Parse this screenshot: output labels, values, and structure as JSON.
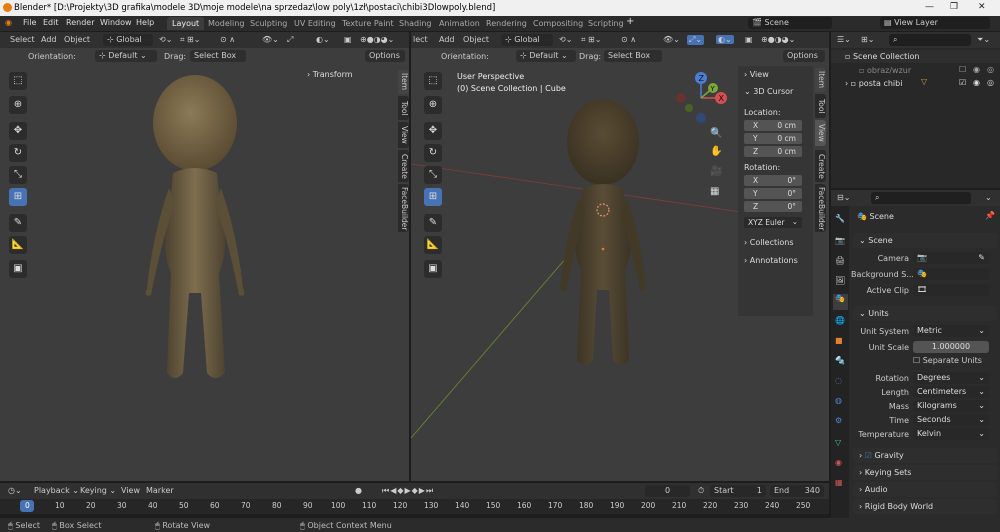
{
  "window": {
    "title": "Blender* [D:\\Projekty\\3D grafika\\modele 3D\\moje modele\\na sprzedaz\\low poly\\1zł\\postaci\\chibi3Dlowpoly.blend]"
  },
  "menus": [
    "File",
    "Edit",
    "Render",
    "Window",
    "Help"
  ],
  "workspaces": [
    "Layout",
    "Modeling",
    "Sculpting",
    "UV Editing",
    "Texture Paint",
    "Shading",
    "Animation",
    "Rendering",
    "Compositing",
    "Scripting"
  ],
  "scene": {
    "label": "Scene",
    "view_layer": "View Layer"
  },
  "left_viewport": {
    "header": {
      "select": "Select",
      "add": "Add",
      "object": "Object",
      "orientation_global": "Global"
    },
    "sub": {
      "orientation_label": "Orientation:",
      "orientation": "Default",
      "drag_label": "Drag:",
      "drag": "Select Box",
      "options": "Options"
    },
    "transform": "Transform",
    "tabs": [
      "Item",
      "Tool",
      "View",
      "Create",
      "FaceBuilder"
    ]
  },
  "right_viewport": {
    "header": {
      "select": "lect",
      "add": "Add",
      "object": "Object",
      "orientation_global": "Global"
    },
    "sub": {
      "orientation_label": "Orientation:",
      "orientation": "Default",
      "drag_label": "Drag:",
      "drag": "Select Box",
      "options": "Options"
    },
    "overlay_line1": "User Perspective",
    "overlay_line2": "(0) Scene Collection | Cube",
    "gizmo": {
      "x": "X",
      "y": "Y",
      "z": "Z"
    },
    "npanel": {
      "view": "View",
      "cursor": "3D Cursor",
      "location": "Location:",
      "loc": [
        {
          "axis": "X",
          "value": "0 cm"
        },
        {
          "axis": "Y",
          "value": "0 cm"
        },
        {
          "axis": "Z",
          "value": "0 cm"
        }
      ],
      "rotation": "Rotation:",
      "rot": [
        {
          "axis": "X",
          "value": "0°"
        },
        {
          "axis": "Y",
          "value": "0°"
        },
        {
          "axis": "Z",
          "value": "0°"
        }
      ],
      "rot_mode": "XYZ Euler",
      "collections": "Collections",
      "annotations": "Annotations"
    },
    "tabs": [
      "Item",
      "Tool",
      "View",
      "Create",
      "FaceBuilder"
    ]
  },
  "outliner": {
    "root": "Scene Collection",
    "items": [
      {
        "name": "obraz/wzur"
      },
      {
        "name": "posta chibi"
      }
    ]
  },
  "properties": {
    "title": "Scene",
    "scene_section": "Scene",
    "camera": "Camera",
    "background": "Background S...",
    "active_clip": "Active Clip",
    "units_section": "Units",
    "unit_system_lbl": "Unit System",
    "unit_system": "Metric",
    "unit_scale_lbl": "Unit Scale",
    "unit_scale": "1.000000",
    "separate_units": "Separate Units",
    "rotation_lbl": "Rotation",
    "rotation": "Degrees",
    "length_lbl": "Length",
    "length": "Centimeters",
    "mass_lbl": "Mass",
    "mass": "Kilograms",
    "time_lbl": "Time",
    "time": "Seconds",
    "temperature_lbl": "Temperature",
    "temperature": "Kelvin",
    "gravity": "Gravity",
    "keying_sets": "Keying Sets",
    "audio": "Audio",
    "rigid_body": "Rigid Body World"
  },
  "timeline": {
    "menus": [
      "Playback",
      "Keying",
      "View",
      "Marker"
    ],
    "current": "0",
    "start_lbl": "Start",
    "start": "1",
    "end_lbl": "End",
    "end": "340",
    "ticks": [
      "0",
      "10",
      "20",
      "30",
      "40",
      "50",
      "60",
      "70",
      "80",
      "90",
      "100",
      "110",
      "120",
      "130",
      "140",
      "150",
      "160",
      "170",
      "180",
      "190",
      "200",
      "210",
      "220",
      "230",
      "240",
      "250"
    ]
  },
  "status": {
    "select": "Select",
    "box_select": "Box Select",
    "rotate_view": "Rotate View",
    "context_menu": "Object Context Menu"
  }
}
